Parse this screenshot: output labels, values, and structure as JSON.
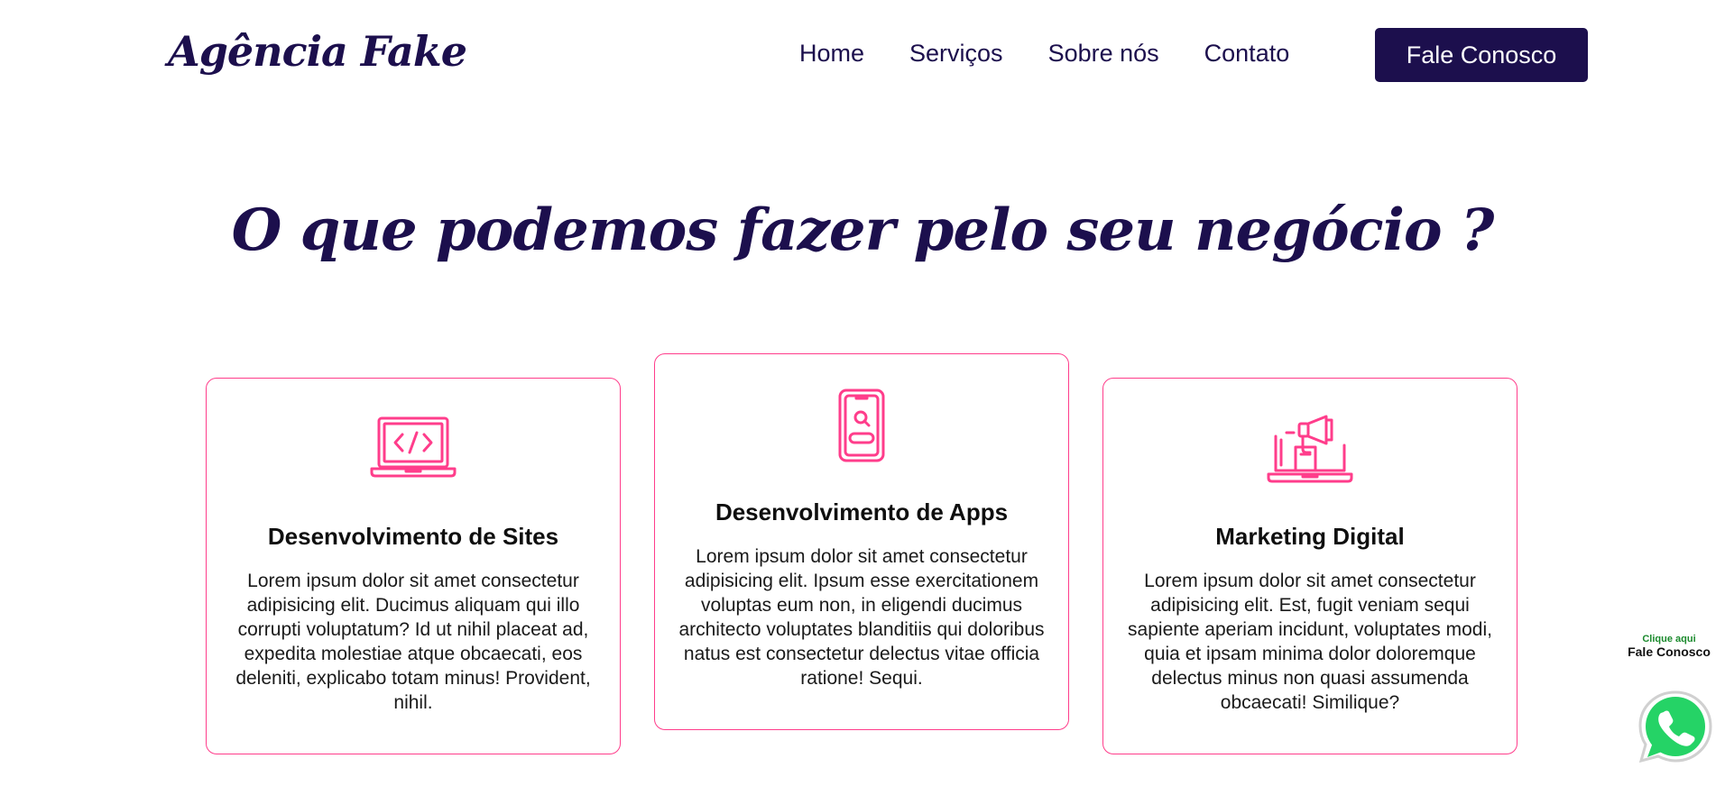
{
  "header": {
    "logo": "Agência Fake",
    "nav": [
      "Home",
      "Serviços",
      "Sobre nós",
      "Contato"
    ],
    "cta_label": "Fale Conosco"
  },
  "services": {
    "title": "O que podemos fazer pelo seu negócio ?",
    "cards": [
      {
        "icon": "laptop-code-icon",
        "title": "Desenvolvimento de Sites",
        "text": "Lorem ipsum dolor sit amet consectetur adipisicing elit. Ducimus aliquam qui illo corrupti voluptatum? Id ut nihil placeat ad, expedita molestiae atque obcaecati, eos deleniti, explicabo totam minus! Provident, nihil."
      },
      {
        "icon": "mobile-search-icon",
        "title": "Desenvolvimento de Apps",
        "text": "Lorem ipsum dolor sit amet consectetur adipisicing elit. Ipsum esse exercitationem voluptas eum non, in eligendi ducimus architecto voluptates blanditiis qui doloribus natus est consectetur delectus vitae officia ratione! Sequi."
      },
      {
        "icon": "laptop-megaphone-icon",
        "title": "Marketing Digital",
        "text": "Lorem ipsum dolor sit amet consectetur adipisicing elit. Est, fugit veniam sequi sapiente aperiam incidunt, voluptates modi, quia et ipsam minima dolor doloremque delectus minus non quasi assumenda obcaecati! Similique?"
      }
    ]
  },
  "whatsapp": {
    "small_label": "Clique aqui",
    "big_label": "Fale Conosco",
    "icon": "whatsapp-icon"
  },
  "colors": {
    "primary": "#1c0f4d",
    "accent": "#ff3d8b",
    "whatsapp": "#25d366"
  }
}
